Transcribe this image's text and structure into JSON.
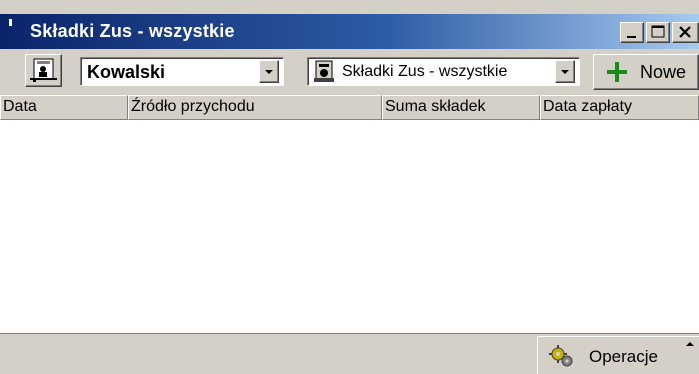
{
  "window": {
    "title": "Składki Zus - wszystkie",
    "controls": {
      "minimize_icon": "minimize-icon",
      "maximize_icon": "maximize-icon",
      "close_icon": "close-icon"
    }
  },
  "toolbar": {
    "person_button_icon": "person-card-icon",
    "person_select": {
      "value": "Kowalski"
    },
    "view_select": {
      "icon": "document-stamp-icon",
      "value": "Składki Zus - wszystkie"
    },
    "new_button": {
      "label": "Nowe",
      "icon": "plus-icon",
      "icon_color": "#1a8a1a"
    }
  },
  "table": {
    "columns": [
      "Data",
      "Źródło przychodu",
      "Suma składek",
      "Data zapłaty"
    ],
    "rows": []
  },
  "statusbar": {
    "operations_button": {
      "label": "Operacje",
      "icon": "gears-icon"
    }
  },
  "colors": {
    "titlebar_start": "#0a246a",
    "titlebar_end": "#a6caf0",
    "face": "#d4d0c8"
  }
}
